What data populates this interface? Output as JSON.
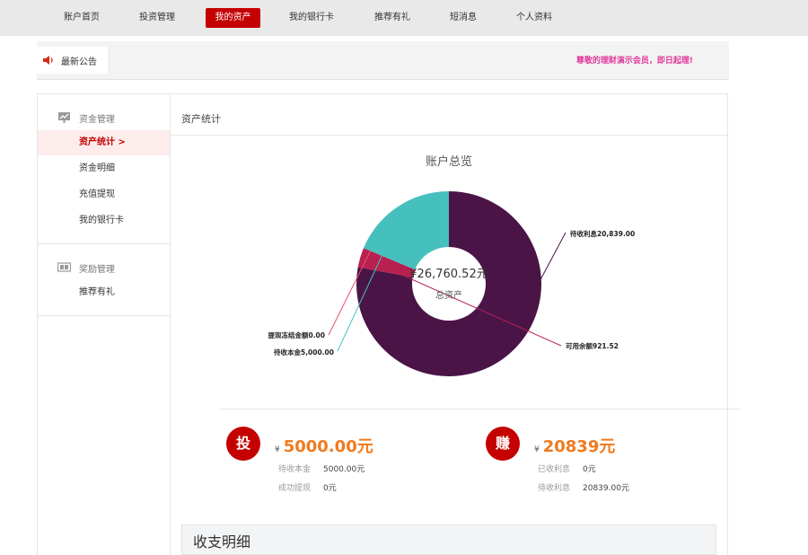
{
  "nav": {
    "items": [
      {
        "label": "账户首页",
        "active": false
      },
      {
        "label": "投资管理",
        "active": false
      },
      {
        "label": "我的资产",
        "active": true
      },
      {
        "label": "我的银行卡",
        "active": false
      },
      {
        "label": "推荐有礼",
        "active": false
      },
      {
        "label": "短消息",
        "active": false
      },
      {
        "label": "个人资料",
        "active": false
      }
    ]
  },
  "notice": {
    "tab_label": "最新公告",
    "icon": "speaker-icon",
    "message": "尊敬的理财演示会员，即日起理!"
  },
  "sidebar": {
    "groups": [
      {
        "title": "资金管理",
        "icon": "fund-management-icon",
        "items": [
          "资产统计 >",
          "资金明细",
          "充值提现",
          "我的银行卡"
        ]
      },
      {
        "title": "奖励管理",
        "icon": "reward-management-icon",
        "items": [
          "推荐有礼"
        ]
      }
    ],
    "active_item": "资产统计 >"
  },
  "content": {
    "title": "资产统计",
    "chart_title": "账户总览"
  },
  "chart_data": {
    "type": "pie",
    "title": "账户总览",
    "center_value": "¥26,760.52元",
    "center_label": "总资产",
    "slices": [
      {
        "label": "待收利息20,839.00",
        "value": 20839.0,
        "color": "#4a1447"
      },
      {
        "label": "可用余额921.52",
        "value": 921.52,
        "color": "#b8204f"
      },
      {
        "label": "提现冻结金额0.00",
        "value": 0.0,
        "color": "#e8516a"
      },
      {
        "label": "待收本金5,000.00",
        "value": 5000.0,
        "color": "#45c0bd"
      }
    ]
  },
  "invest_card": {
    "badge": "投",
    "currency": "¥",
    "amount": "5000.00元",
    "rows": [
      {
        "k": "待收本金",
        "v": "5000.00元"
      },
      {
        "k": "成功提现",
        "v": "0元"
      }
    ]
  },
  "earn_card": {
    "badge": "赚",
    "currency": "¥",
    "amount": "20839元",
    "rows": [
      {
        "k": "已收利息",
        "v": "0元"
      },
      {
        "k": "待收利息",
        "v": "20839.00元"
      }
    ]
  },
  "details": {
    "title": "收支明细"
  },
  "colors": {
    "brand_red": "#c40000",
    "accent_orange": "#f07a1e",
    "notice_pink": "#e0389a"
  }
}
